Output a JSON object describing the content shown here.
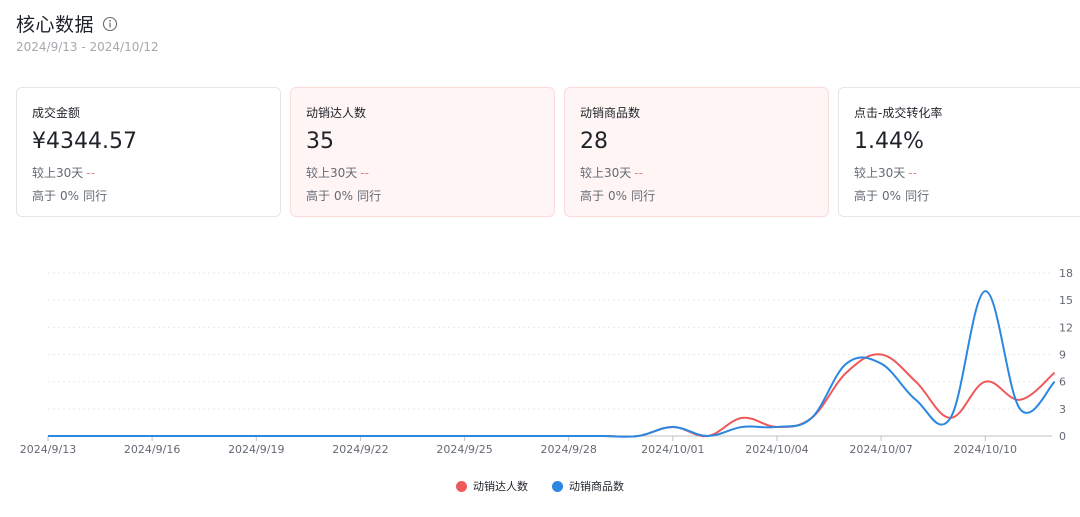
{
  "header": {
    "title": "核心数据",
    "date_range": "2024/9/13 - 2024/10/12"
  },
  "cards": [
    {
      "label": "成交金额",
      "value": "¥4344.57",
      "compare_label": "较上30天",
      "compare_value": "--",
      "peer_text": "高于",
      "peer_value": "0%",
      "peer_suffix": "同行",
      "active": false
    },
    {
      "label": "动销达人数",
      "value": "35",
      "compare_label": "较上30天",
      "compare_value": "--",
      "peer_text": "高于",
      "peer_value": "0%",
      "peer_suffix": "同行",
      "active": true
    },
    {
      "label": "动销商品数",
      "value": "28",
      "compare_label": "较上30天",
      "compare_value": "--",
      "peer_text": "高于",
      "peer_value": "0%",
      "peer_suffix": "同行",
      "active": true
    },
    {
      "label": "点击-成交转化率",
      "value": "1.44%",
      "compare_label": "较上30天",
      "compare_value": "--",
      "peer_text": "高于",
      "peer_value": "0%",
      "peer_suffix": "同行",
      "active": false
    }
  ],
  "colors": {
    "series_red": "#ee5a5a",
    "series_blue": "#2b87e0"
  },
  "chart_data": {
    "type": "line",
    "x_ticks": [
      "2024/9/13",
      "2024/9/16",
      "2024/9/19",
      "2024/9/22",
      "2024/9/25",
      "2024/9/28",
      "2024/10/01",
      "2024/10/04",
      "2024/10/07",
      "2024/10/10"
    ],
    "x": [
      "2024/9/13",
      "2024/9/14",
      "2024/9/15",
      "2024/9/16",
      "2024/9/17",
      "2024/9/18",
      "2024/9/19",
      "2024/9/20",
      "2024/9/21",
      "2024/9/22",
      "2024/9/23",
      "2024/9/24",
      "2024/9/25",
      "2024/9/26",
      "2024/9/27",
      "2024/9/28",
      "2024/9/29",
      "2024/9/30",
      "2024/10/01",
      "2024/10/02",
      "2024/10/03",
      "2024/10/04",
      "2024/10/05",
      "2024/10/06",
      "2024/10/07",
      "2024/10/08",
      "2024/10/09",
      "2024/10/10",
      "2024/10/11",
      "2024/10/12"
    ],
    "series": [
      {
        "name": "动销达人数",
        "color": "#ee5a5a",
        "values": [
          0,
          0,
          0,
          0,
          0,
          0,
          0,
          0,
          0,
          0,
          0,
          0,
          0,
          0,
          0,
          0,
          0,
          0,
          1,
          0,
          2,
          1,
          2,
          7,
          9,
          6,
          2,
          6,
          4,
          7
        ]
      },
      {
        "name": "动销商品数",
        "color": "#2b87e0",
        "values": [
          0,
          0,
          0,
          0,
          0,
          0,
          0,
          0,
          0,
          0,
          0,
          0,
          0,
          0,
          0,
          0,
          0,
          0,
          1,
          0,
          1,
          1,
          2,
          8,
          8,
          4,
          2,
          16,
          3,
          6
        ]
      }
    ],
    "y_ticks": [
      0,
      3,
      6,
      9,
      12,
      15,
      18
    ],
    "ylim": [
      0,
      18
    ],
    "y_axis_position": "right",
    "grid": true,
    "legend_position": "bottom-center"
  }
}
